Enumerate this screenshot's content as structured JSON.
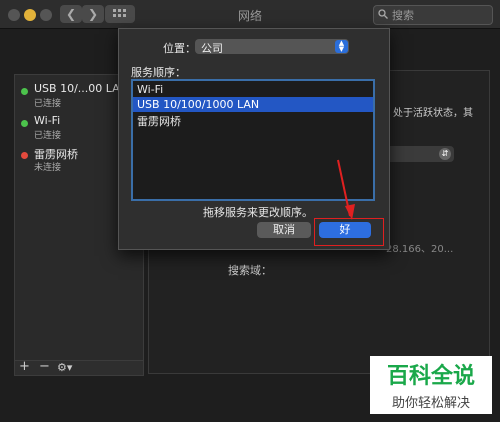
{
  "window": {
    "title": "网络",
    "search_placeholder": "搜索"
  },
  "sidebar": {
    "items": [
      {
        "name": "USB 10/...00 LAN",
        "status": "已连接",
        "color": "#4cc34c"
      },
      {
        "name": "Wi-Fi",
        "status": "已连接",
        "color": "#4cc34c"
      },
      {
        "name": "雷雳网桥",
        "status": "未连接",
        "color": "#e34a3d"
      }
    ],
    "tools": [
      "+",
      "−",
      "⚙▾"
    ]
  },
  "background": {
    "status_text": "处于活跃状态，其",
    "ip_fragment": "28.166、20...",
    "search_domain_label": "搜索域："
  },
  "sheet": {
    "location_label": "位置：",
    "location_value": "公司",
    "service_order_label": "服务顺序：",
    "services": [
      "Wi-Fi",
      "USB 10/100/1000 LAN",
      "雷雳网桥"
    ],
    "selected_index": 1,
    "hint": "拖移服务来更改顺序。",
    "cancel_label": "取消",
    "ok_label": "好"
  },
  "watermark": {
    "title": "百科全说",
    "subtitle": "助你轻松解决"
  },
  "colors": {
    "accent": "#2d6ee0",
    "annotation": "#e02020",
    "watermark_green": "#1aa84a"
  }
}
